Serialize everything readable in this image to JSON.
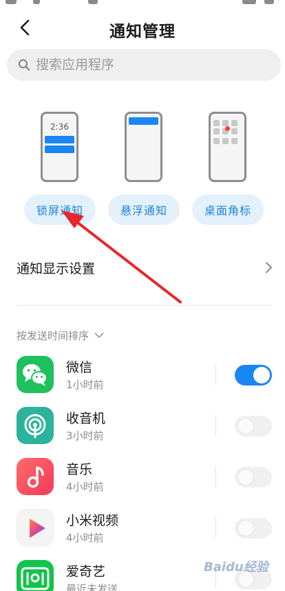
{
  "header": {
    "title": "通知管理"
  },
  "search": {
    "placeholder": "搜索应用程序"
  },
  "notification_types": {
    "lockscreen_clock": "2:36",
    "items": [
      {
        "label": "锁屏通知"
      },
      {
        "label": "悬浮通知"
      },
      {
        "label": "桌面角标"
      }
    ]
  },
  "settings": {
    "display_label": "通知显示设置"
  },
  "sort": {
    "label": "按发送时间排序"
  },
  "apps": [
    {
      "name": "微信",
      "time": "1小时前",
      "enabled": true,
      "icon": "wechat-icon"
    },
    {
      "name": "收音机",
      "time": "3小时前",
      "enabled": false,
      "icon": "radio-icon"
    },
    {
      "name": "音乐",
      "time": "4小时前",
      "enabled": false,
      "icon": "music-icon"
    },
    {
      "name": "小米视频",
      "time": "4小时前",
      "enabled": false,
      "icon": "mi-video-icon"
    },
    {
      "name": "爱奇艺",
      "time": "最近未发送",
      "enabled": false,
      "icon": "iqiyi-icon"
    }
  ],
  "colors": {
    "accent": "#1a86f4",
    "annotation_arrow": "#e8262b"
  },
  "watermark": "Baidu经验"
}
